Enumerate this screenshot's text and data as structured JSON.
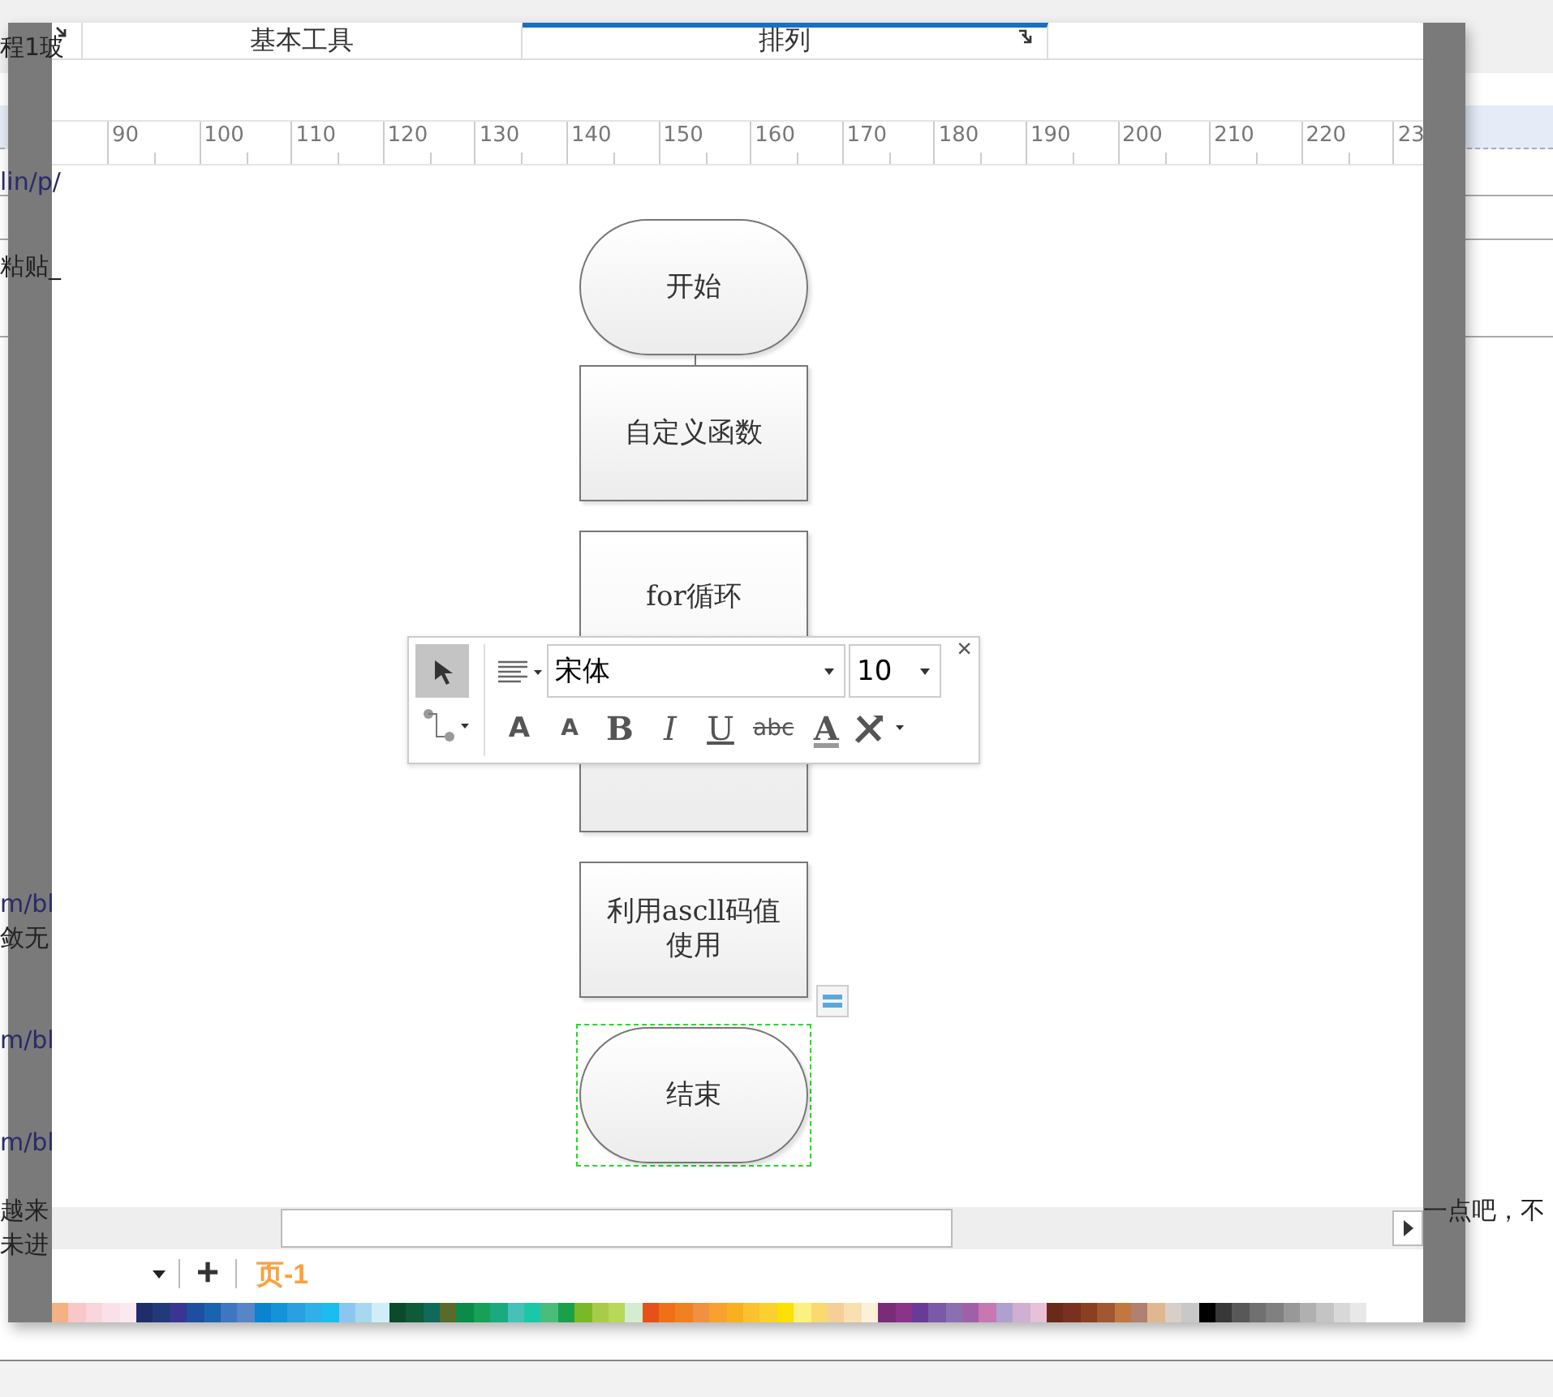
{
  "background_text": [
    "程1玻",
    "lin/p/",
    "粘贴_",
    "m/bl",
    "敛无",
    "m/bl",
    "m/bl",
    "越来",
    "未进",
    "一点吧，不"
  ],
  "tabs": [
    {
      "label": "基本工具",
      "selected": false
    },
    {
      "label": "排列",
      "selected": true
    }
  ],
  "ruler": [
    "90",
    "100",
    "110",
    "120",
    "130",
    "140",
    "150",
    "160",
    "170",
    "180",
    "190",
    "200",
    "210",
    "220",
    "23"
  ],
  "flowchart": {
    "nodes": [
      {
        "kind": "terminal",
        "label": "开始",
        "selected": false
      },
      {
        "kind": "process",
        "label": "自定义函数",
        "selected": false
      },
      {
        "kind": "process_tall",
        "label": "for循环",
        "selected": false
      },
      {
        "kind": "process",
        "label": "利用ascll码值使用",
        "selected": false
      },
      {
        "kind": "terminal",
        "label": "结束",
        "selected": true
      }
    ]
  },
  "text_toolbar": {
    "font": "宋体",
    "size": "10",
    "close": "×",
    "buttons": [
      {
        "kind": "grow",
        "label": "A"
      },
      {
        "kind": "shrink",
        "label": "A"
      },
      {
        "kind": "bold",
        "label": "B"
      },
      {
        "kind": "italic",
        "label": "I"
      },
      {
        "kind": "underline",
        "label": "U"
      },
      {
        "kind": "strike",
        "label": "abc"
      },
      {
        "kind": "color",
        "label": "A"
      }
    ]
  },
  "page_tabs": {
    "add": "+",
    "pages": [
      {
        "label": "页-1",
        "selected": true
      }
    ]
  },
  "palette": [
    {
      "color": "#f4b183"
    },
    {
      "color": "#f8c8c8"
    },
    {
      "color": "#f9d5dc"
    },
    {
      "color": "#fbe0ea"
    },
    {
      "color": "#fce8f0"
    },
    {
      "color": "#1f2d6b"
    },
    {
      "color": "#233a7a"
    },
    {
      "color": "#3a3592"
    },
    {
      "color": "#1d4fa0"
    },
    {
      "color": "#1a63b0"
    },
    {
      "color": "#3f76c0"
    },
    {
      "color": "#5884c8"
    },
    {
      "color": "#0a84d0"
    },
    {
      "color": "#1394d8"
    },
    {
      "color": "#2aa0e0"
    },
    {
      "color": "#30b0e8"
    },
    {
      "color": "#1cbcf0"
    },
    {
      "color": "#8ac6f0"
    },
    {
      "color": "#a8d8f0"
    },
    {
      "color": "#d0eef8"
    },
    {
      "color": "#0b4a2a"
    },
    {
      "color": "#0f5a38"
    },
    {
      "color": "#0f6a5a"
    },
    {
      "color": "#5a6a2a"
    },
    {
      "color": "#0b8a4a"
    },
    {
      "color": "#17a058"
    },
    {
      "color": "#1aaa80"
    },
    {
      "color": "#46c0b8"
    },
    {
      "color": "#1ac8a8"
    },
    {
      "color": "#4cbc7c"
    },
    {
      "color": "#1aa04a"
    },
    {
      "color": "#7ab828"
    },
    {
      "color": "#a8cc48"
    },
    {
      "color": "#b8d858"
    },
    {
      "color": "#d4ecd0"
    },
    {
      "color": "#e8501a"
    },
    {
      "color": "#f07018"
    },
    {
      "color": "#f08020"
    },
    {
      "color": "#f09040"
    },
    {
      "color": "#f8a030"
    },
    {
      "color": "#f8b020"
    },
    {
      "color": "#fcc030"
    },
    {
      "color": "#fcd030"
    },
    {
      "color": "#fce000"
    },
    {
      "color": "#fcf080"
    },
    {
      "color": "#fcd870"
    },
    {
      "color": "#f4d098"
    },
    {
      "color": "#f8e0b0"
    },
    {
      "color": "#fcf0d8"
    },
    {
      "color": "#7a2c78"
    },
    {
      "color": "#8a3488"
    },
    {
      "color": "#6a3a98"
    },
    {
      "color": "#7a5aa8"
    },
    {
      "color": "#8a70b0"
    },
    {
      "color": "#a060a8"
    },
    {
      "color": "#c878b0"
    },
    {
      "color": "#b0a0d0"
    },
    {
      "color": "#d0b0d0"
    },
    {
      "color": "#e8c0d8"
    },
    {
      "color": "#6a2a1a"
    },
    {
      "color": "#7a3020"
    },
    {
      "color": "#8a4020"
    },
    {
      "color": "#a05830"
    },
    {
      "color": "#c07840"
    },
    {
      "color": "#b08070"
    },
    {
      "color": "#e0b890"
    },
    {
      "color": "#d8d0c8"
    },
    {
      "color": "#c8c8c8"
    },
    {
      "color": "#000000"
    },
    {
      "color": "#383838"
    },
    {
      "color": "#585858"
    },
    {
      "color": "#707070"
    },
    {
      "color": "#808080"
    },
    {
      "color": "#989898"
    },
    {
      "color": "#b0b0b0"
    },
    {
      "color": "#c4c4c4"
    },
    {
      "color": "#d8d8d8"
    },
    {
      "color": "#e8e8e8"
    }
  ]
}
